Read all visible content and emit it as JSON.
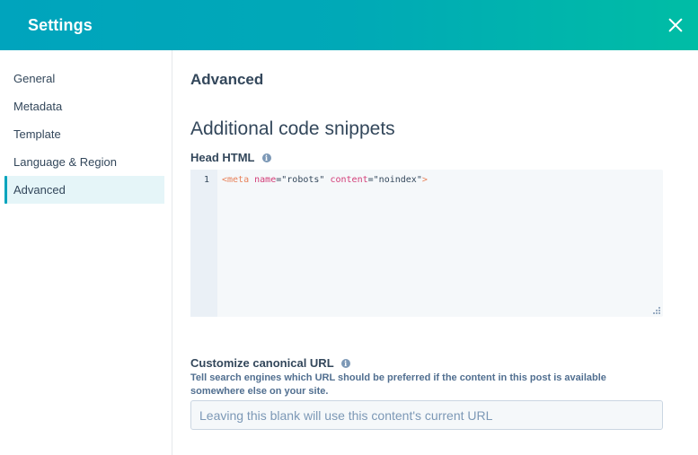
{
  "header": {
    "title": "Settings",
    "close_icon": "close-x-icon"
  },
  "sidebar": {
    "items": [
      {
        "label": "General",
        "active": false
      },
      {
        "label": "Metadata",
        "active": false
      },
      {
        "label": "Template",
        "active": false
      },
      {
        "label": "Language & Region",
        "active": false
      },
      {
        "label": "Advanced",
        "active": true
      }
    ]
  },
  "main": {
    "section_title": "Advanced",
    "subsection_title": "Additional code snippets",
    "head_html": {
      "label": "Head HTML",
      "info_icon": "info-icon",
      "line_number": "1",
      "code": {
        "open": "<meta",
        "attr1": "name",
        "eq1": "=",
        "val1": "\"robots\"",
        "attr2": "content",
        "eq2": "=",
        "val2": "\"noindex\"",
        "close": ">"
      }
    },
    "canonical": {
      "label": "Customize canonical URL",
      "info_icon": "info-icon",
      "help_text": "Tell search engines which URL should be preferred if the content in this post is available somewhere else on your site.",
      "input_value": "",
      "input_placeholder": "Leaving this blank will use this content's current URL"
    }
  },
  "colors": {
    "header_gradient_start": "#00a4bd",
    "header_gradient_end": "#00bda5",
    "active_nav_bg": "#e5f5f8",
    "active_nav_indicator": "#00a4bd",
    "text_primary": "#33475b"
  }
}
